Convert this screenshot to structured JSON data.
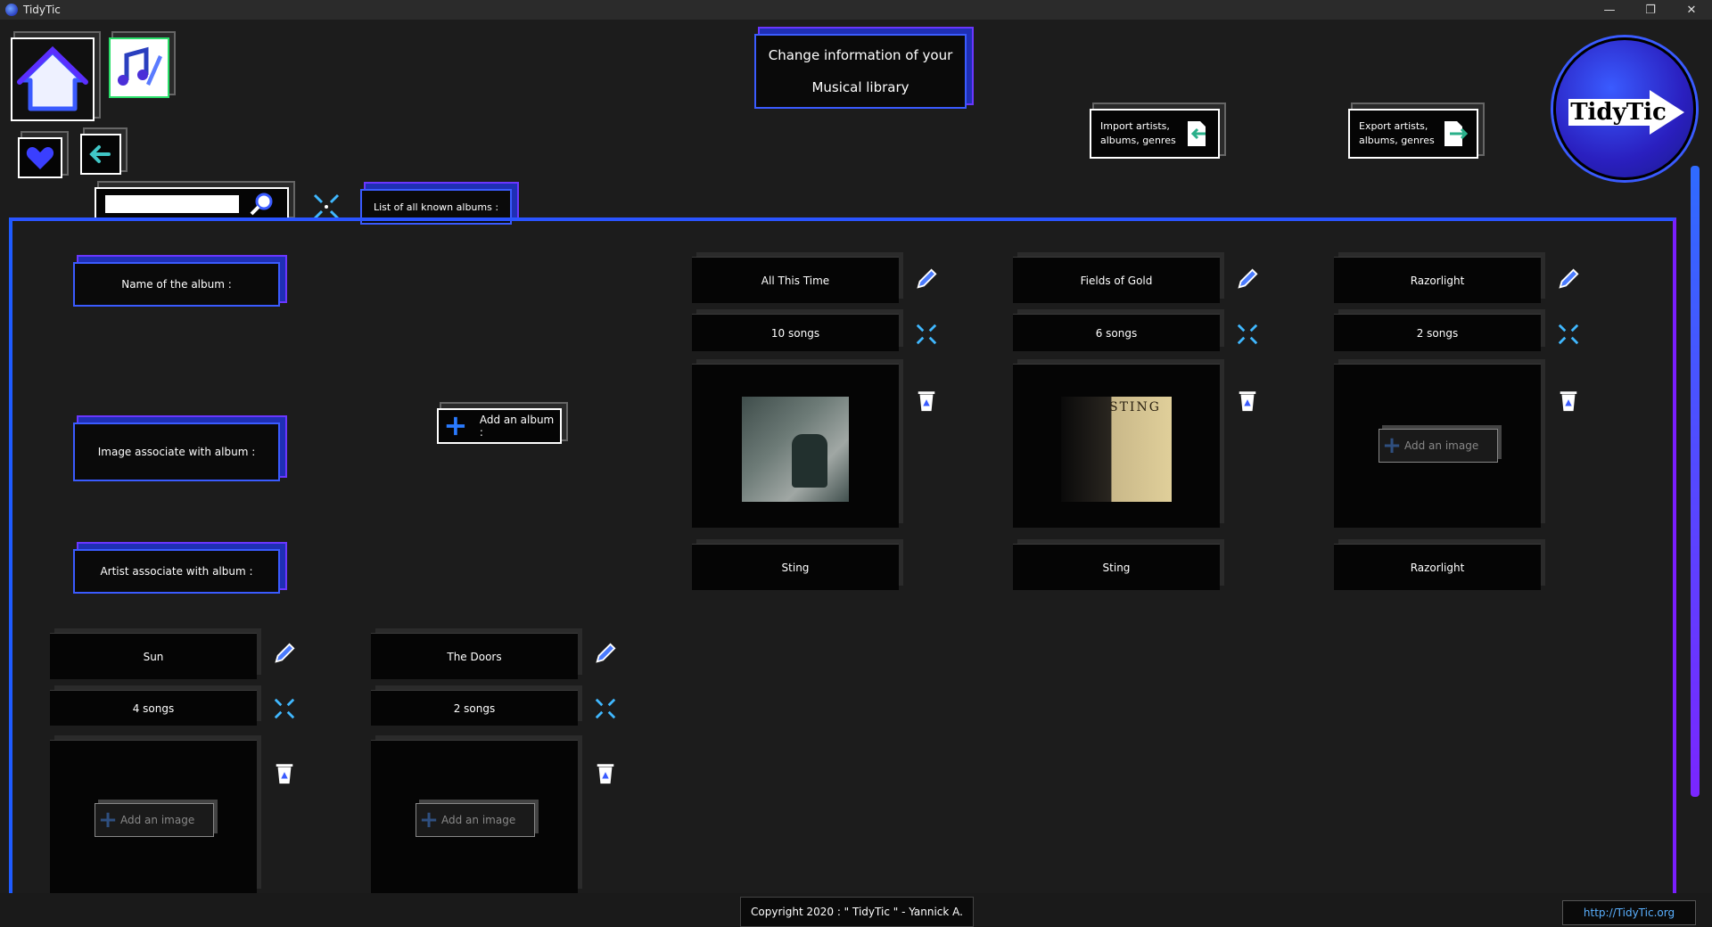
{
  "window": {
    "title": "TidyTic",
    "controls": [
      "—",
      "❐",
      "✕"
    ]
  },
  "header": {
    "title_line1": "Change information of your",
    "title_line2": "Musical library",
    "import_label": "Import artists, albums, genres",
    "export_label": "Export artists, albums, genres",
    "logo_text": "TidyTic"
  },
  "search": {
    "placeholder": "",
    "list_tab_label": "List of all known albums :"
  },
  "form": {
    "name_label": "Name of the album :",
    "image_label": "Image associate with album :",
    "artist_label": "Artist associate with album :",
    "add_album_label": "Add an album :"
  },
  "albums": [
    {
      "name": "All This Time",
      "songs": "10 songs",
      "artist": "Sting",
      "has_image": true,
      "cover_color": "#5d6b68"
    },
    {
      "name": "Fields of Gold",
      "songs": "6 songs",
      "artist": "Sting",
      "has_image": true,
      "cover_color": "#c9b889",
      "cover_text": "STING"
    },
    {
      "name": "Razorlight",
      "songs": "2 songs",
      "artist": "Razorlight",
      "has_image": false,
      "add_image_label": "Add an image"
    },
    {
      "name": "Sun",
      "songs": "4 songs",
      "has_image": false,
      "add_image_label": "Add an image"
    },
    {
      "name": "The Doors",
      "songs": "2 songs",
      "has_image": false,
      "add_image_label": "Add an image"
    }
  ],
  "footer": {
    "copyright": "Copyright 2020 : \" TidyTic \" - Yannick A.",
    "url": "http://TidyTic.org"
  },
  "colors": {
    "accent_blue": "#2a54ff",
    "accent_purple": "#7a1fff",
    "background": "#1c1c1c"
  },
  "icons": [
    "home-icon",
    "music-edit-icon",
    "heart-icon",
    "back-arrow-icon",
    "search-icon",
    "expand-icon",
    "pencil-icon",
    "trash-icon",
    "plus-icon",
    "import-icon",
    "export-icon"
  ]
}
